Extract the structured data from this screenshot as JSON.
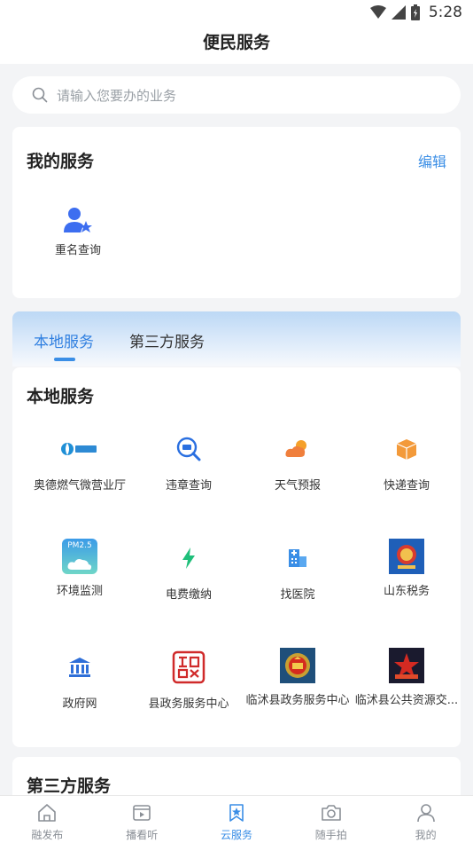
{
  "status_bar": {
    "time": "5:28"
  },
  "header": {
    "title": "便民服务"
  },
  "search": {
    "placeholder": "请输入您要办的业务"
  },
  "my_services": {
    "title": "我的服务",
    "edit_label": "编辑",
    "items": [
      {
        "label": "重名查询",
        "icon": "user-star-icon"
      }
    ]
  },
  "tabs": [
    {
      "label": "本地服务",
      "active": true
    },
    {
      "label": "第三方服务",
      "active": false
    }
  ],
  "local_services": {
    "title": "本地服务",
    "items": [
      {
        "label": "奥德燃气微营业厅",
        "icon": "aode-gas-logo"
      },
      {
        "label": "违章查询",
        "icon": "traffic-violation-icon"
      },
      {
        "label": "天气预报",
        "icon": "weather-icon"
      },
      {
        "label": "快递查询",
        "icon": "package-icon"
      },
      {
        "label": "环境监测",
        "icon": "pm25-cloud-icon",
        "icon_text": "PM2.5"
      },
      {
        "label": "电费缴纳",
        "icon": "lightning-icon"
      },
      {
        "label": "找医院",
        "icon": "hospital-icon"
      },
      {
        "label": "山东税务",
        "icon": "tax-emblem-icon"
      },
      {
        "label": "政府网",
        "icon": "government-building-icon"
      },
      {
        "label": "县政务服务中心",
        "icon": "seal-stamp-icon"
      },
      {
        "label": "临沭县政务服务中心",
        "icon": "national-emblem-icon"
      },
      {
        "label": "临沭县公共资源交...",
        "icon": "red-star-emblem-icon"
      }
    ]
  },
  "third_party_services": {
    "title": "第三方服务"
  },
  "bottom_nav": [
    {
      "label": "融发布",
      "icon": "home-icon",
      "active": false
    },
    {
      "label": "播看听",
      "icon": "video-icon",
      "active": false
    },
    {
      "label": "云服务",
      "icon": "bookmark-star-icon",
      "active": true
    },
    {
      "label": "随手拍",
      "icon": "camera-icon",
      "active": false
    },
    {
      "label": "我的",
      "icon": "user-icon",
      "active": false
    }
  ],
  "colors": {
    "accent": "#3a8ee6",
    "background": "#f3f4f6",
    "text": "#222222"
  }
}
